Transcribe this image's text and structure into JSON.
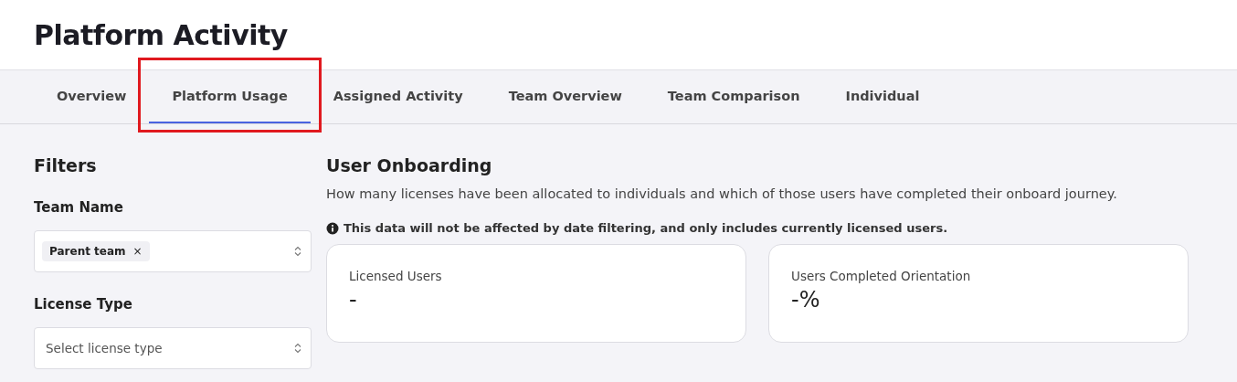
{
  "page": {
    "title": "Platform Activity"
  },
  "tabs": [
    {
      "label": "Overview",
      "selected": false,
      "highlighted": false
    },
    {
      "label": "Platform Usage",
      "selected": true,
      "highlighted": true
    },
    {
      "label": "Assigned Activity",
      "selected": false,
      "highlighted": false
    },
    {
      "label": "Team Overview",
      "selected": false,
      "highlighted": false
    },
    {
      "label": "Team Comparison",
      "selected": false,
      "highlighted": false
    },
    {
      "label": "Individual",
      "selected": false,
      "highlighted": false
    }
  ],
  "filters": {
    "title": "Filters",
    "fields": [
      {
        "label": "Team Name",
        "chips": [
          "Parent team"
        ],
        "remove_icon": "×"
      },
      {
        "label": "License Type",
        "placeholder": "Select license type"
      }
    ]
  },
  "section": {
    "title": "User Onboarding",
    "description": "How many licenses have been allocated to individuals and which of those users have completed their onboard journey.",
    "note": "This data will not be affected by date filtering, and only includes currently licensed users.",
    "cards": [
      {
        "label": "Licensed Users",
        "value": "-"
      },
      {
        "label": "Users Completed Orientation",
        "value": "-%"
      }
    ]
  }
}
